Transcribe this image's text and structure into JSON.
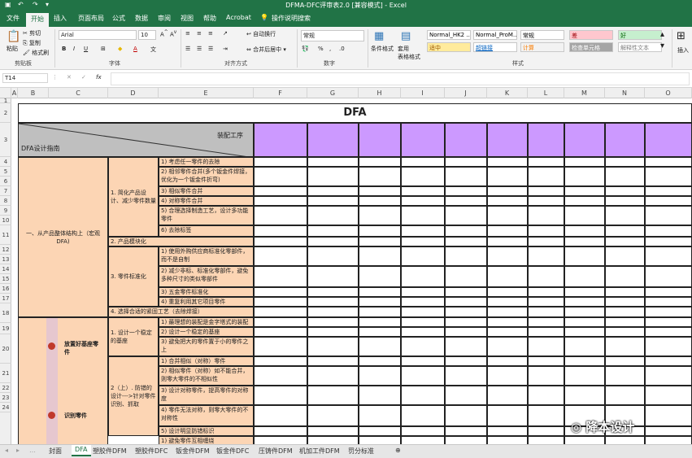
{
  "window": {
    "title": "DFMA-DFC评审表2.0  [兼容模式]  -  Excel"
  },
  "ribbon_tabs": [
    "文件",
    "开始",
    "插入",
    "页面布局",
    "公式",
    "数据",
    "审阅",
    "视图",
    "帮助",
    "Acrobat",
    "操作说明搜索"
  ],
  "ribbon": {
    "paste": "粘贴",
    "cut": "剪切",
    "copy": "复制",
    "format_painter": "格式刷",
    "clipboard_group": "剪贴板",
    "font_name": "Arial",
    "font_size": "10",
    "font_group": "字体",
    "wrap_text": "自动换行",
    "merge_center": "合并后居中",
    "align_group": "对齐方式",
    "number_format": "常规",
    "number_group": "数字",
    "cond_format": "条件格式",
    "table_format": "套用\n表格格式",
    "styles_group": "样式",
    "insert": "插入",
    "styles": [
      {
        "label": "Normal_HK2 ...",
        "bg": "#ffffff",
        "fg": "#000000"
      },
      {
        "label": "Normal_ProM...",
        "bg": "#ffffff",
        "fg": "#000000"
      },
      {
        "label": "常规",
        "bg": "#ffffff",
        "fg": "#000000"
      },
      {
        "label": "差",
        "bg": "#ffc7ce",
        "fg": "#9c0006"
      },
      {
        "label": "好",
        "bg": "#c6efce",
        "fg": "#006100"
      },
      {
        "label": "适中",
        "bg": "#ffeb9c",
        "fg": "#9c5700"
      },
      {
        "label": "超链接",
        "bg": "#ffffff",
        "fg": "#0563c1"
      },
      {
        "label": "计算",
        "bg": "#f2f2f2",
        "fg": "#fa7d00"
      },
      {
        "label": "检查单元格",
        "bg": "#a5a5a5",
        "fg": "#ffffff"
      },
      {
        "label": "解释性文本",
        "bg": "#ffffff",
        "fg": "#7f7f7f"
      }
    ]
  },
  "formula_bar": {
    "name_box": "T14",
    "fx": "fx",
    "content": ""
  },
  "columns": [
    "A",
    "B",
    "C",
    "D",
    "E",
    "F",
    "G",
    "H",
    "I",
    "J",
    "K",
    "L",
    "M",
    "N",
    "O"
  ],
  "rows": [
    "1",
    "2",
    "3",
    "4",
    "5",
    "6",
    "7",
    "8",
    "9",
    "10",
    "11",
    "12",
    "13",
    "14",
    "15",
    "16",
    "17",
    "18",
    "19",
    "20",
    "21",
    "22",
    "23",
    "24"
  ],
  "sheet": {
    "title": "DFA",
    "header_top": "装配工序",
    "header_bottom": "DFA设计指南",
    "sec1": "一、从产品整体结构上（宏观DFA)",
    "sub1": "1. 简化产品设计、减少零件数量",
    "items1": [
      "1) 考虑任一零件的去除",
      "2) 相邻零件合并(多个钣金件焊接，优化为一个钣金件折弯)",
      "3) 相似零件合并",
      "4) 对称零件合并",
      "5) 合理选择制造工艺，设计多功能零件",
      "6) 去除标签"
    ],
    "sub2": "2. 产品模块化",
    "sub3": "3. 零件标准化",
    "items3": [
      "1) 使用外购供应商标准化零部件，而不是自制",
      "2) 减少非标、标准化零部件，避免多种尺寸的类似零部件",
      "3) 五金零件标准化",
      "4) 重复利用其它项目零件"
    ],
    "sub4": "4. 选择合适的紧固工艺（去除焊接）",
    "flow1": "放置好基座零件",
    "flow2": "识别零件",
    "sub5": "1. 设计一个稳定的基座",
    "items5": [
      "1) 最理想的装配是金字塔式的装配",
      "2) 设计一个稳定的基座",
      "3) 避免把大的零件置于小的零件之上"
    ],
    "sub6": "2（上）. 防错的设计--->针对零件识别、抓取",
    "items6": [
      "1) 合并相似（对称）零件",
      "2) 相似零件（对称）如不能合并，则零大零件的不相似性",
      "3) 设计对称零件，提高零件的对称度",
      "4) 零件无法对称，则零大零件的不对称性",
      "5) 设计明显防错标识",
      "1) 避免零件互相缠绕"
    ]
  },
  "sheet_tabs": [
    "封面",
    "DFA",
    "塑胶件DFM",
    "塑胶件DFC",
    "钣金件DFM",
    "钣金件DFC",
    "压铸件DFM",
    "机加工件DFM",
    "罚分标准"
  ],
  "watermark": "降本设计"
}
